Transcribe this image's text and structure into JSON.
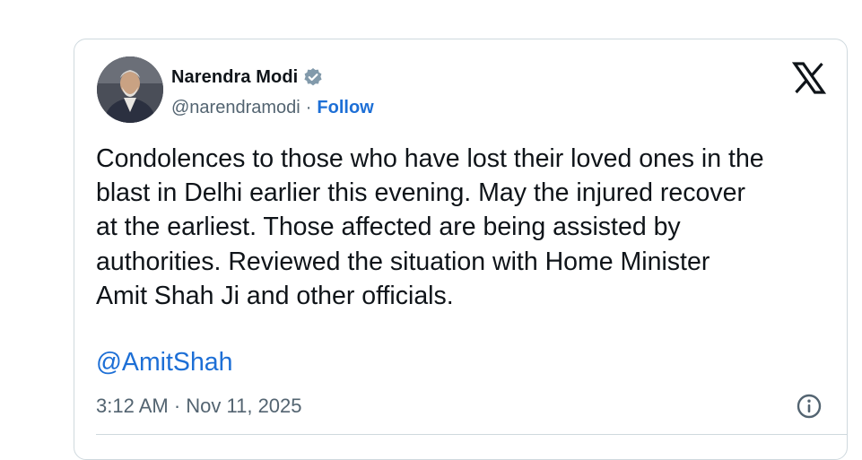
{
  "author": {
    "name": "Narendra Modi",
    "handle": "@narendramodi",
    "separator": "·",
    "follow_label": "Follow"
  },
  "icons": {
    "verified": "verified-badge-icon",
    "platform": "x-logo-icon",
    "info": "info-icon"
  },
  "tweet": {
    "text": "Condolences to those who have lost their loved ones in the\nblast in Delhi earlier this evening. May the injured recover\nat the earliest. Those affected are being assisted by\nauthorities. Reviewed the situation with Home Minister\nAmit Shah Ji and other officials.",
    "mention": "@AmitShah",
    "timestamp": "3:12 AM · Nov 11, 2025"
  },
  "colors": {
    "link": "#1d6fd6",
    "text": "#0f1419",
    "muted": "#536471",
    "border": "#cfd9de"
  }
}
